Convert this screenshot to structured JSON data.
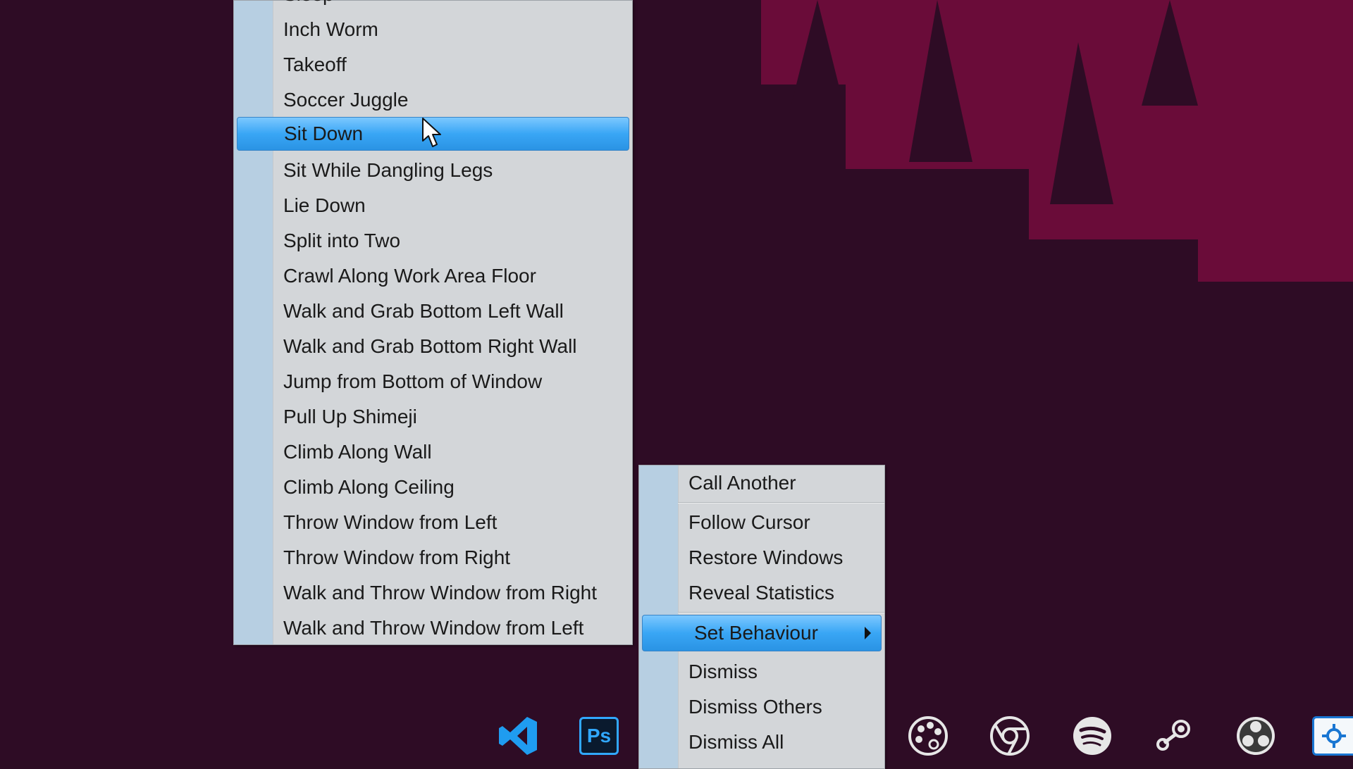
{
  "behaviour_menu": {
    "partial_top_item": "Sleep",
    "items": [
      "Inch Worm",
      "Takeoff",
      "Soccer Juggle",
      "Sit Down",
      "Sit While Dangling Legs",
      "Lie Down",
      "Split into Two",
      "Crawl Along Work Area Floor",
      "Walk and Grab Bottom Left Wall",
      "Walk and Grab Bottom Right Wall",
      "Jump from Bottom of Window",
      "Pull Up Shimeji",
      "Climb Along Wall",
      "Climb Along Ceiling",
      "Throw Window from Left",
      "Throw Window from Right",
      "Walk and Throw Window from Right",
      "Walk and Throw Window from Left"
    ],
    "selected": "Sit Down"
  },
  "context_menu": {
    "call_another": "Call Another",
    "follow_cursor": "Follow Cursor",
    "restore_windows": "Restore Windows",
    "reveal_statistics": "Reveal Statistics",
    "set_behaviour": "Set Behaviour",
    "dismiss": "Dismiss",
    "dismiss_others": "Dismiss Others",
    "dismiss_all": "Dismiss All"
  },
  "taskbar": {
    "photoshop_label": "Ps",
    "icons": [
      "vscode-icon",
      "photoshop-icon",
      "palette-icon",
      "chrome-icon",
      "spotify-icon",
      "steam-icon",
      "obs-icon",
      "settings-app-icon"
    ]
  },
  "colors": {
    "highlight": "#39a6f5",
    "menu_bg": "#d3d6d9",
    "gutter": "#b7cfe2",
    "wallpaper": "#2e0c25",
    "wallpaper_accent": "#6a0c39"
  }
}
